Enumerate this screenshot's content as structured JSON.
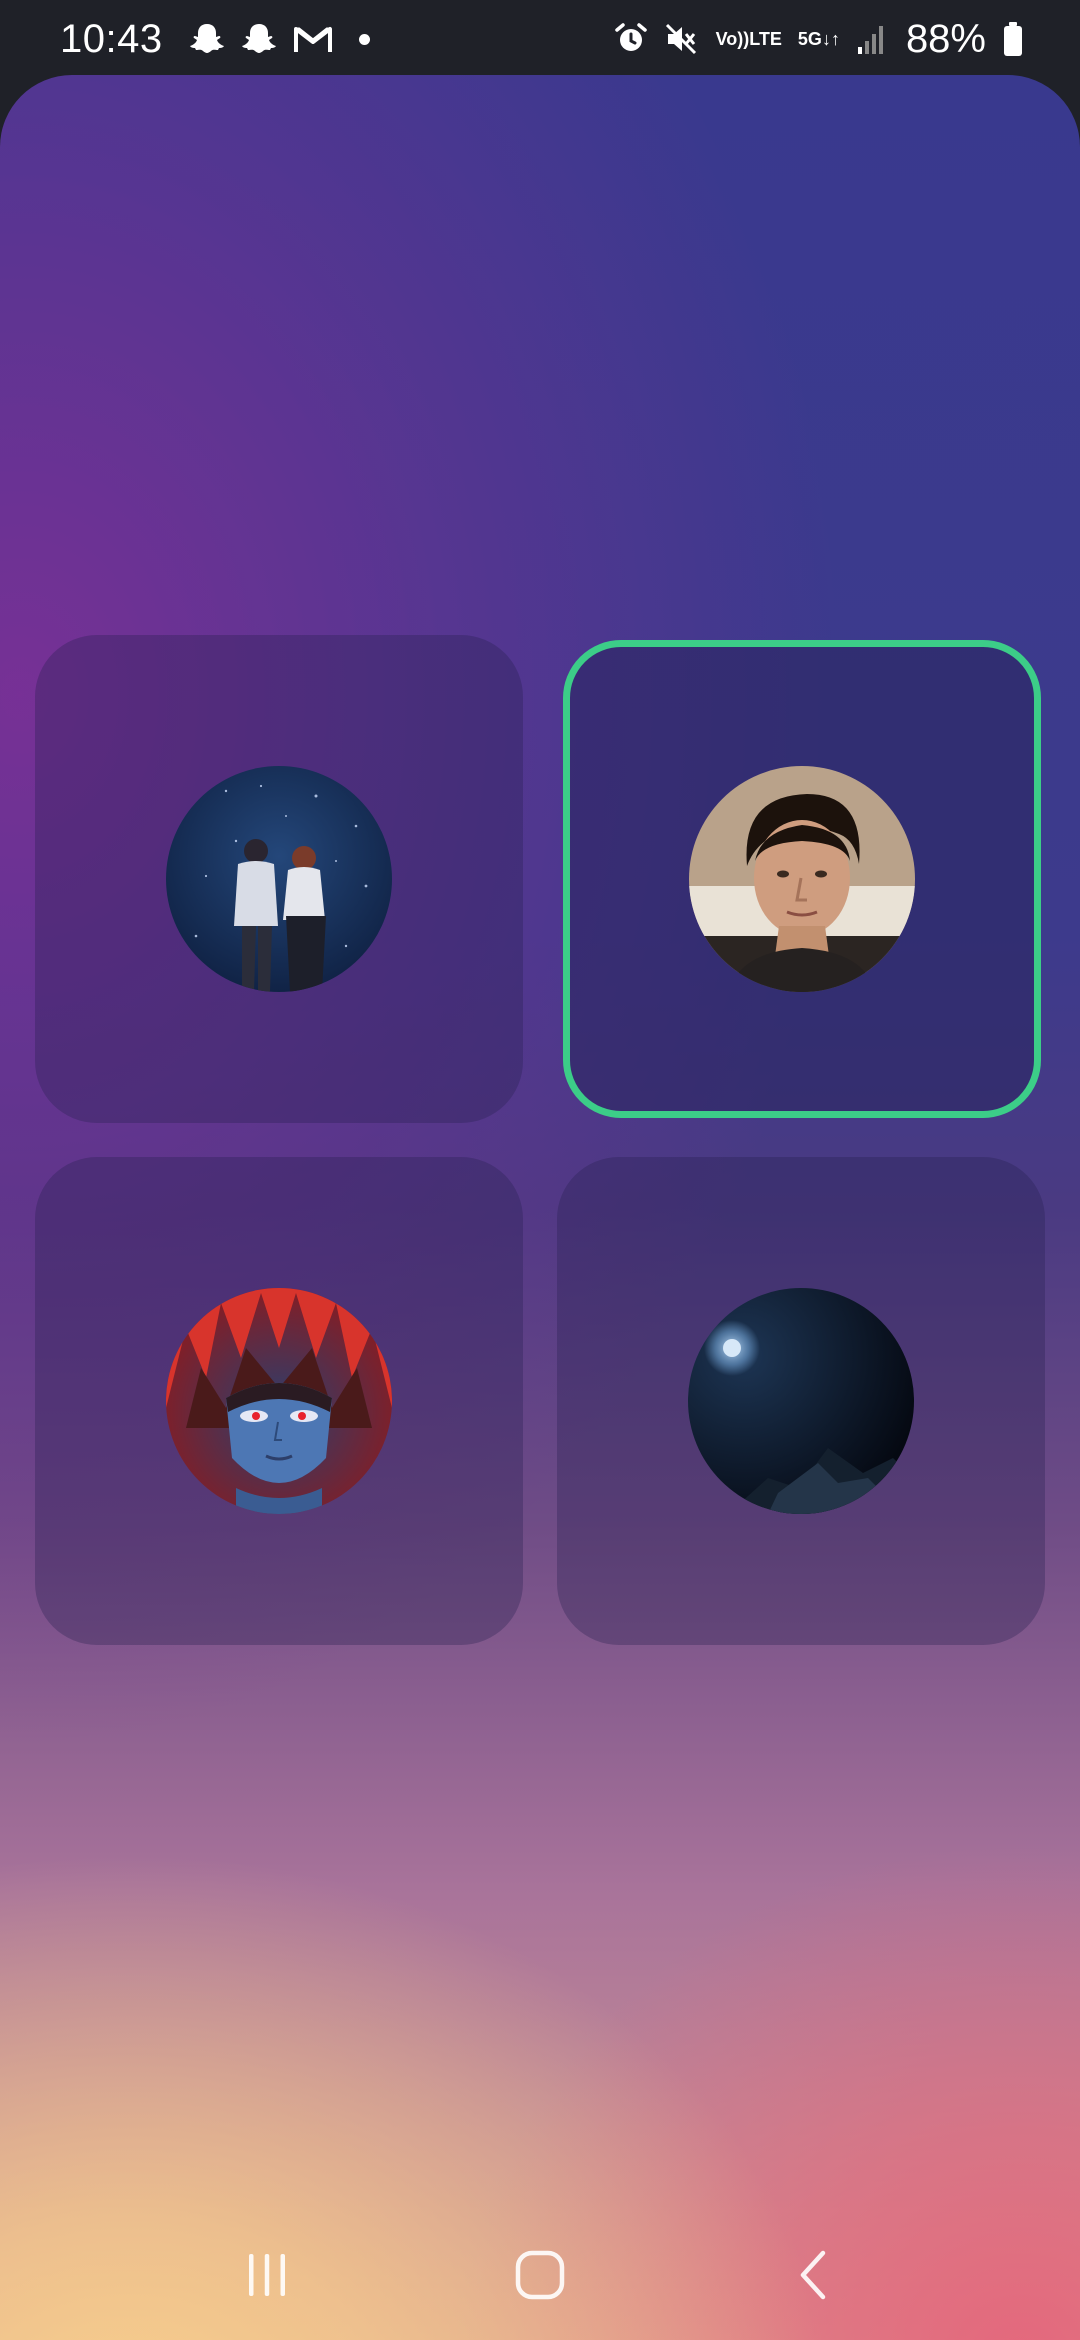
{
  "status_bar": {
    "time": "10:43",
    "left_icons": [
      "snapchat-icon",
      "snapchat-icon",
      "gmail-icon",
      "notification-dot"
    ],
    "volte_top": "Vo))",
    "volte_bottom": "LTE",
    "network_label": "5G",
    "battery_percent": "88%",
    "right_icons": [
      "alarm-icon",
      "mute-icon",
      "volte-icon",
      "5g-icon",
      "signal-icon",
      "battery-icon"
    ]
  },
  "profiles": [
    {
      "id": "profile-1",
      "avatar": "two-figures-starry-night",
      "selected": false
    },
    {
      "id": "profile-2",
      "avatar": "man-portrait",
      "selected": true
    },
    {
      "id": "profile-3",
      "avatar": "anime-red-eyed-character",
      "selected": false
    },
    {
      "id": "profile-4",
      "avatar": "moon-night-landscape",
      "selected": false
    }
  ],
  "colors": {
    "selected_border": "#3ccd88",
    "status_bar_bg": "#1f2128",
    "bg_top": "#39398e",
    "bg_bottom_left": "#f7ce8c",
    "bg_bottom_right": "#e4677c"
  },
  "nav_bar": {
    "buttons": [
      "recent-apps-icon",
      "home-icon",
      "back-icon"
    ]
  }
}
